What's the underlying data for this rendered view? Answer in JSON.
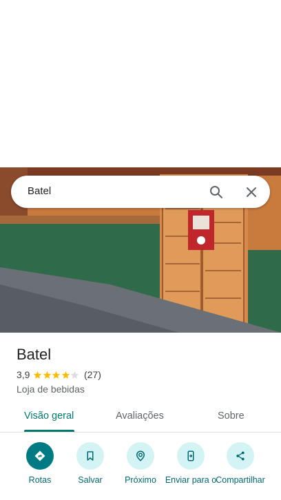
{
  "search": {
    "query": "Batel"
  },
  "place": {
    "name": "Batel",
    "rating": "3,9",
    "rating_stars": 3.9,
    "review_count": "(27)",
    "category": "Loja de bebidas"
  },
  "tabs": [
    {
      "label": "Visão geral",
      "active": true
    },
    {
      "label": "Avaliações",
      "active": false
    },
    {
      "label": "Sobre",
      "active": false
    }
  ],
  "actions": [
    {
      "label": "Rotas",
      "icon": "directions-icon"
    },
    {
      "label": "Salvar",
      "icon": "bookmark-icon"
    },
    {
      "label": "Próximo",
      "icon": "nearby-icon"
    },
    {
      "label": "Enviar para o",
      "icon": "send-to-phone-icon"
    },
    {
      "label": "Compartilhar",
      "icon": "share-icon"
    }
  ],
  "colors": {
    "accent": "#00796b",
    "action_bg": "#d4f3f5",
    "primary_action": "#007b83",
    "star": "#fbbc04"
  }
}
